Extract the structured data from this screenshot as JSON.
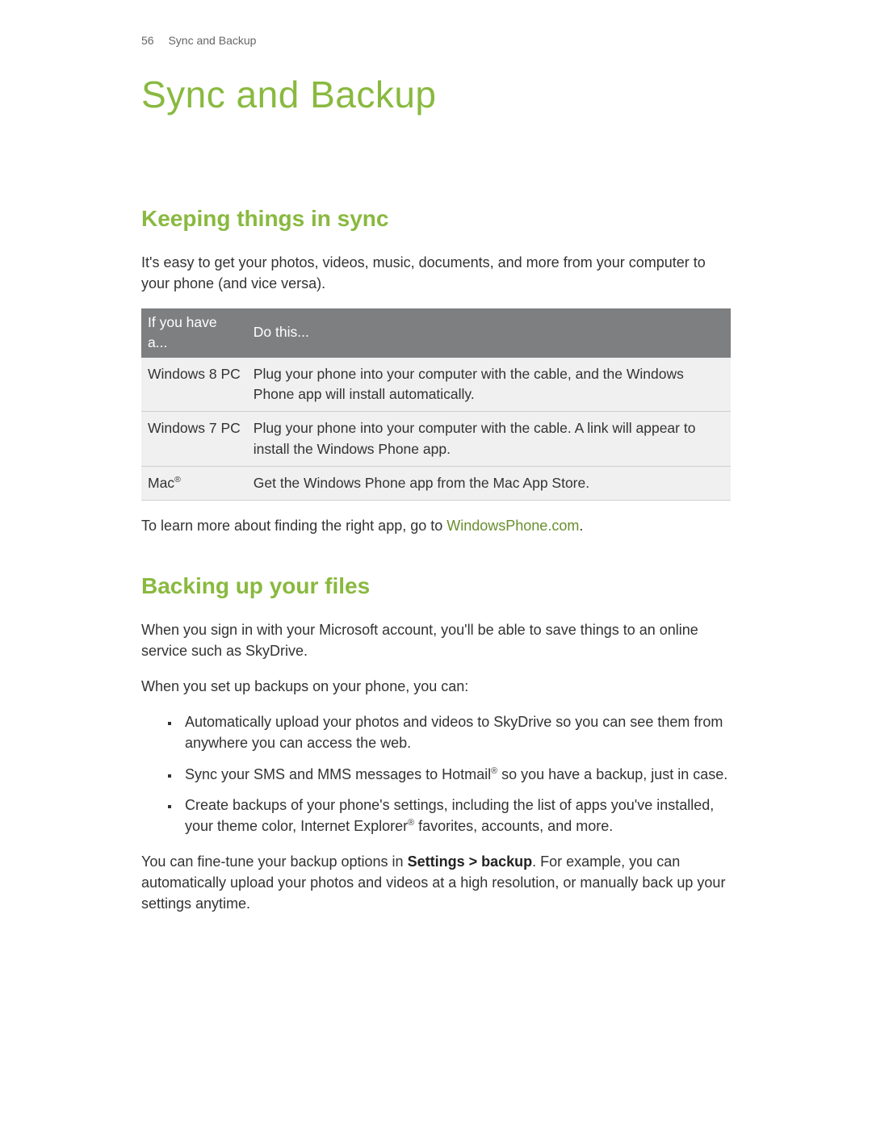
{
  "header": {
    "page_number": "56",
    "section_name": "Sync and Backup"
  },
  "title": "Sync and Backup",
  "section1": {
    "heading": "Keeping things in sync",
    "intro": "It's easy to get your photos, videos, music, documents, and more from your computer to your phone (and vice versa).",
    "table": {
      "head_col1": "If you have a...",
      "head_col2": "Do this...",
      "rows": [
        {
          "col1": "Windows 8 PC",
          "col2": "Plug your phone into your computer with the cable, and the Windows Phone app will install automatically."
        },
        {
          "col1": "Windows 7 PC",
          "col2": "Plug your phone into your computer with the cable. A link will appear to install the Windows Phone app."
        },
        {
          "col1_pre": "Mac",
          "col1_reg": "®",
          "col2": "Get the Windows Phone app from the Mac App Store."
        }
      ]
    },
    "outro_pre": "To learn more about finding the right app, go to ",
    "outro_link": "WindowsPhone.com",
    "outro_post": "."
  },
  "section2": {
    "heading": "Backing up your files",
    "para1": "When you sign in with your Microsoft account, you'll be able to save things to an online service such as SkyDrive.",
    "para2": "When you set up backups on your phone, you can:",
    "bullets": [
      {
        "text": "Automatically upload your photos and videos to SkyDrive so you can see them from anywhere you can access the web."
      },
      {
        "pre": "Sync your SMS and MMS messages to Hotmail",
        "reg": "®",
        "post": " so you have a backup, just in case."
      },
      {
        "pre": "Create backups of your phone's settings, including the list of apps you've installed, your theme color, Internet Explorer",
        "reg": "®",
        "post": " favorites, accounts, and more."
      }
    ],
    "para3_pre": "You can fine-tune your backup options in ",
    "para3_strong": "Settings > backup",
    "para3_post": ". For example, you can automatically upload your photos and videos at a high resolution, or manually back up your settings anytime."
  }
}
